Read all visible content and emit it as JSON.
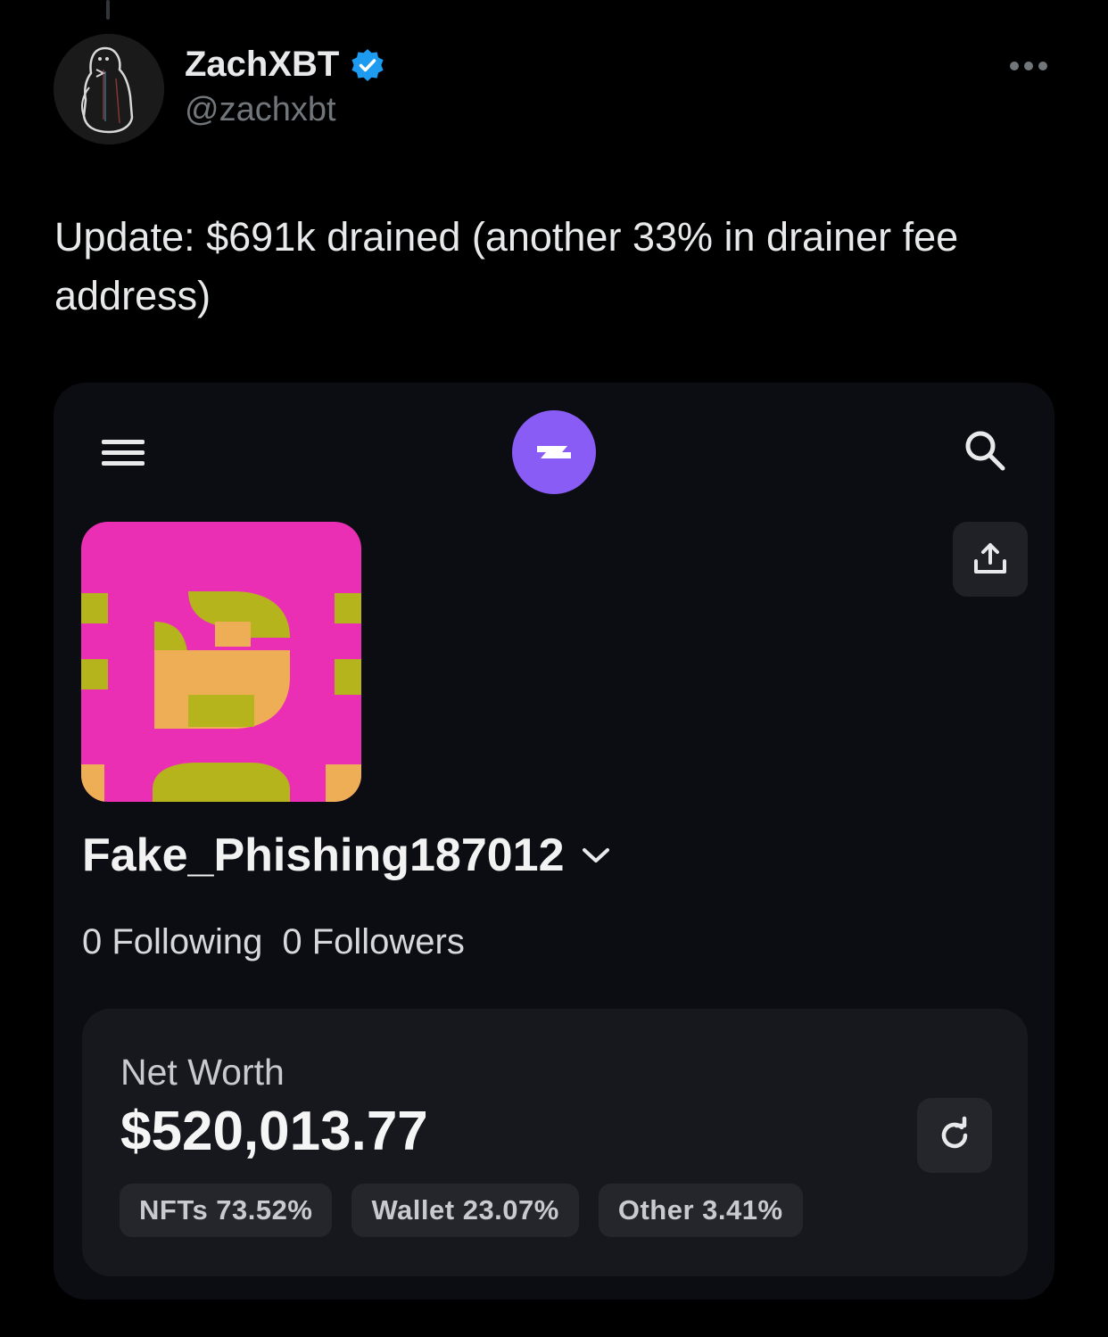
{
  "tweet": {
    "author_name": "ZachXBT",
    "author_handle": "@zachxbt",
    "text": "Update: $691k drained (another 33% in drainer fee address)",
    "icons": {
      "avatar": "penguin-avatar",
      "verified": "verified-badge-icon",
      "more": "more-options-icon"
    }
  },
  "embedded_app": {
    "header": {
      "menu_icon": "hamburger-menu-icon",
      "logo_icon": "zerion-logo-icon",
      "search_icon": "search-icon"
    },
    "profile": {
      "name": "Fake_Phishing187012",
      "following": "0 Following",
      "followers": "0 Followers",
      "share_icon": "share-upload-icon",
      "dropdown_icon": "chevron-down-icon"
    },
    "net_worth": {
      "label": "Net Worth",
      "value": "$520,013.77",
      "refresh_icon": "refresh-icon",
      "breakdown": [
        {
          "label": "NFTs 73.52%",
          "percent": 73.52
        },
        {
          "label": "Wallet 23.07%",
          "percent": 23.07
        },
        {
          "label": "Other 3.41%",
          "percent": 3.41
        }
      ]
    }
  },
  "colors": {
    "background": "#000000",
    "verified_blue": "#1d9bf0",
    "logo_purple": "#8a5cf6",
    "profile_pink": "#ea2fb4",
    "profile_olive": "#b5b41c",
    "profile_orange": "#eeae55"
  }
}
